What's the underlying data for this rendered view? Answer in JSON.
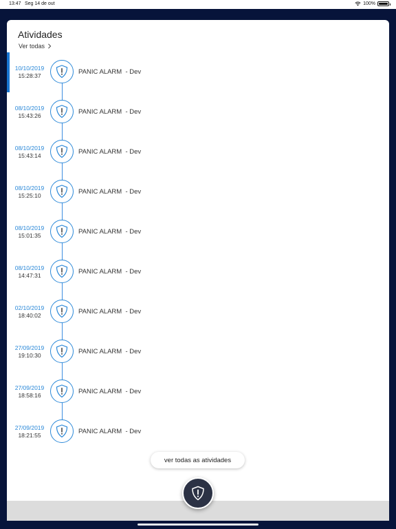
{
  "status_bar": {
    "time": "13:47",
    "date": "Seg 14 de out",
    "battery": "100%"
  },
  "card": {
    "title": "Atividades",
    "see_all": "Ver todas"
  },
  "activities": [
    {
      "date": "10/10/2019",
      "time": "15:28:37",
      "label": "PANIC ALARM  - Dev"
    },
    {
      "date": "08/10/2019",
      "time": "15:43:26",
      "label": "PANIC ALARM  - Dev"
    },
    {
      "date": "08/10/2019",
      "time": "15:43:14",
      "label": "PANIC ALARM  - Dev"
    },
    {
      "date": "08/10/2019",
      "time": "15:25:10",
      "label": "PANIC ALARM  - Dev"
    },
    {
      "date": "08/10/2019",
      "time": "15:01:35",
      "label": "PANIC ALARM  - Dev"
    },
    {
      "date": "08/10/2019",
      "time": "14:47:31",
      "label": "PANIC ALARM  - Dev"
    },
    {
      "date": "02/10/2019",
      "time": "18:40:02",
      "label": "PANIC ALARM  - Dev"
    },
    {
      "date": "27/09/2019",
      "time": "19:10:30",
      "label": "PANIC ALARM  - Dev"
    },
    {
      "date": "27/09/2019",
      "time": "18:58:16",
      "label": "PANIC ALARM  - Dev"
    },
    {
      "date": "27/09/2019",
      "time": "18:21:55",
      "label": "PANIC ALARM  - Dev"
    }
  ],
  "all_activities_button": "ver todas as atividades",
  "icons": {
    "activity": "shield-alert-icon",
    "fab": "shield-alert-icon",
    "see_all": "chevron-right-icon"
  },
  "colors": {
    "accent": "#2a88d8",
    "nav": "#07143a",
    "fab": "#2c3245"
  }
}
